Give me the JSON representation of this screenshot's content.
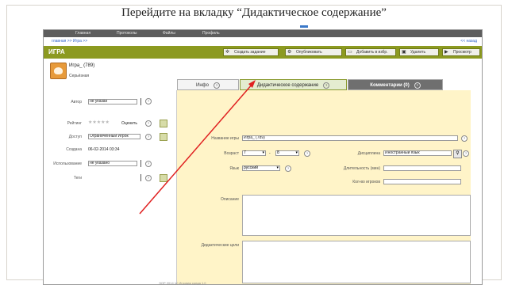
{
  "slide_title": "Перейдите на вкладку “Дидактическое содержание”",
  "topnav": [
    "Главная",
    "Протоколы",
    "Файлы",
    "Профиль"
  ],
  "breadcrumb": "главная >> Игра >>",
  "breadcrumb_right": "<< назад",
  "section_label": "ИГРА",
  "toolbar": {
    "create_task": "Создать задание",
    "publish": "Опубликовать",
    "add_favorite": "Добавить в избр.",
    "delete": "Удалить",
    "view": "Просмотр"
  },
  "game": {
    "name": "Игра_ (789)",
    "type": "Серьёзная"
  },
  "tabs": {
    "info": "Инфо",
    "didactic": "Дидактическое содержание",
    "comments": "Комментарии (0)"
  },
  "left": {
    "row1_label": "Автор",
    "row1_value": "не указан",
    "rating_label": "Рейтинг",
    "rating_value": "Оценить",
    "access_label": "Доступ",
    "access_value": "Ограниченный Игрок",
    "created_label": "Создана",
    "created_value": "06-02-2014 03:34",
    "row5_label": "Использование",
    "row5_value": "не указано",
    "row6_label": "Теги"
  },
  "right": {
    "name_label": "Название игры",
    "name_value": "Игра_ (789)",
    "age_label": "Возраст",
    "age_from": "7",
    "age_dash": "-",
    "age_to": "8",
    "lang_label": "Язык",
    "lang_value": "русский",
    "discipline_label": "Дисциплина",
    "discipline_value": "Иностранный язык",
    "duration_label": "Длительность (мин)",
    "players_label": "Кол-во игроков",
    "desc_label": "Описание",
    "goals_label": "Дидактические цели"
  },
  "footer": "ЭОР 2014 (c) Игровая среда 1.0",
  "colors": {
    "accent_green": "#8c9a20",
    "panel_yellow": "#fff4c8",
    "arrow_red": "#e02020"
  }
}
